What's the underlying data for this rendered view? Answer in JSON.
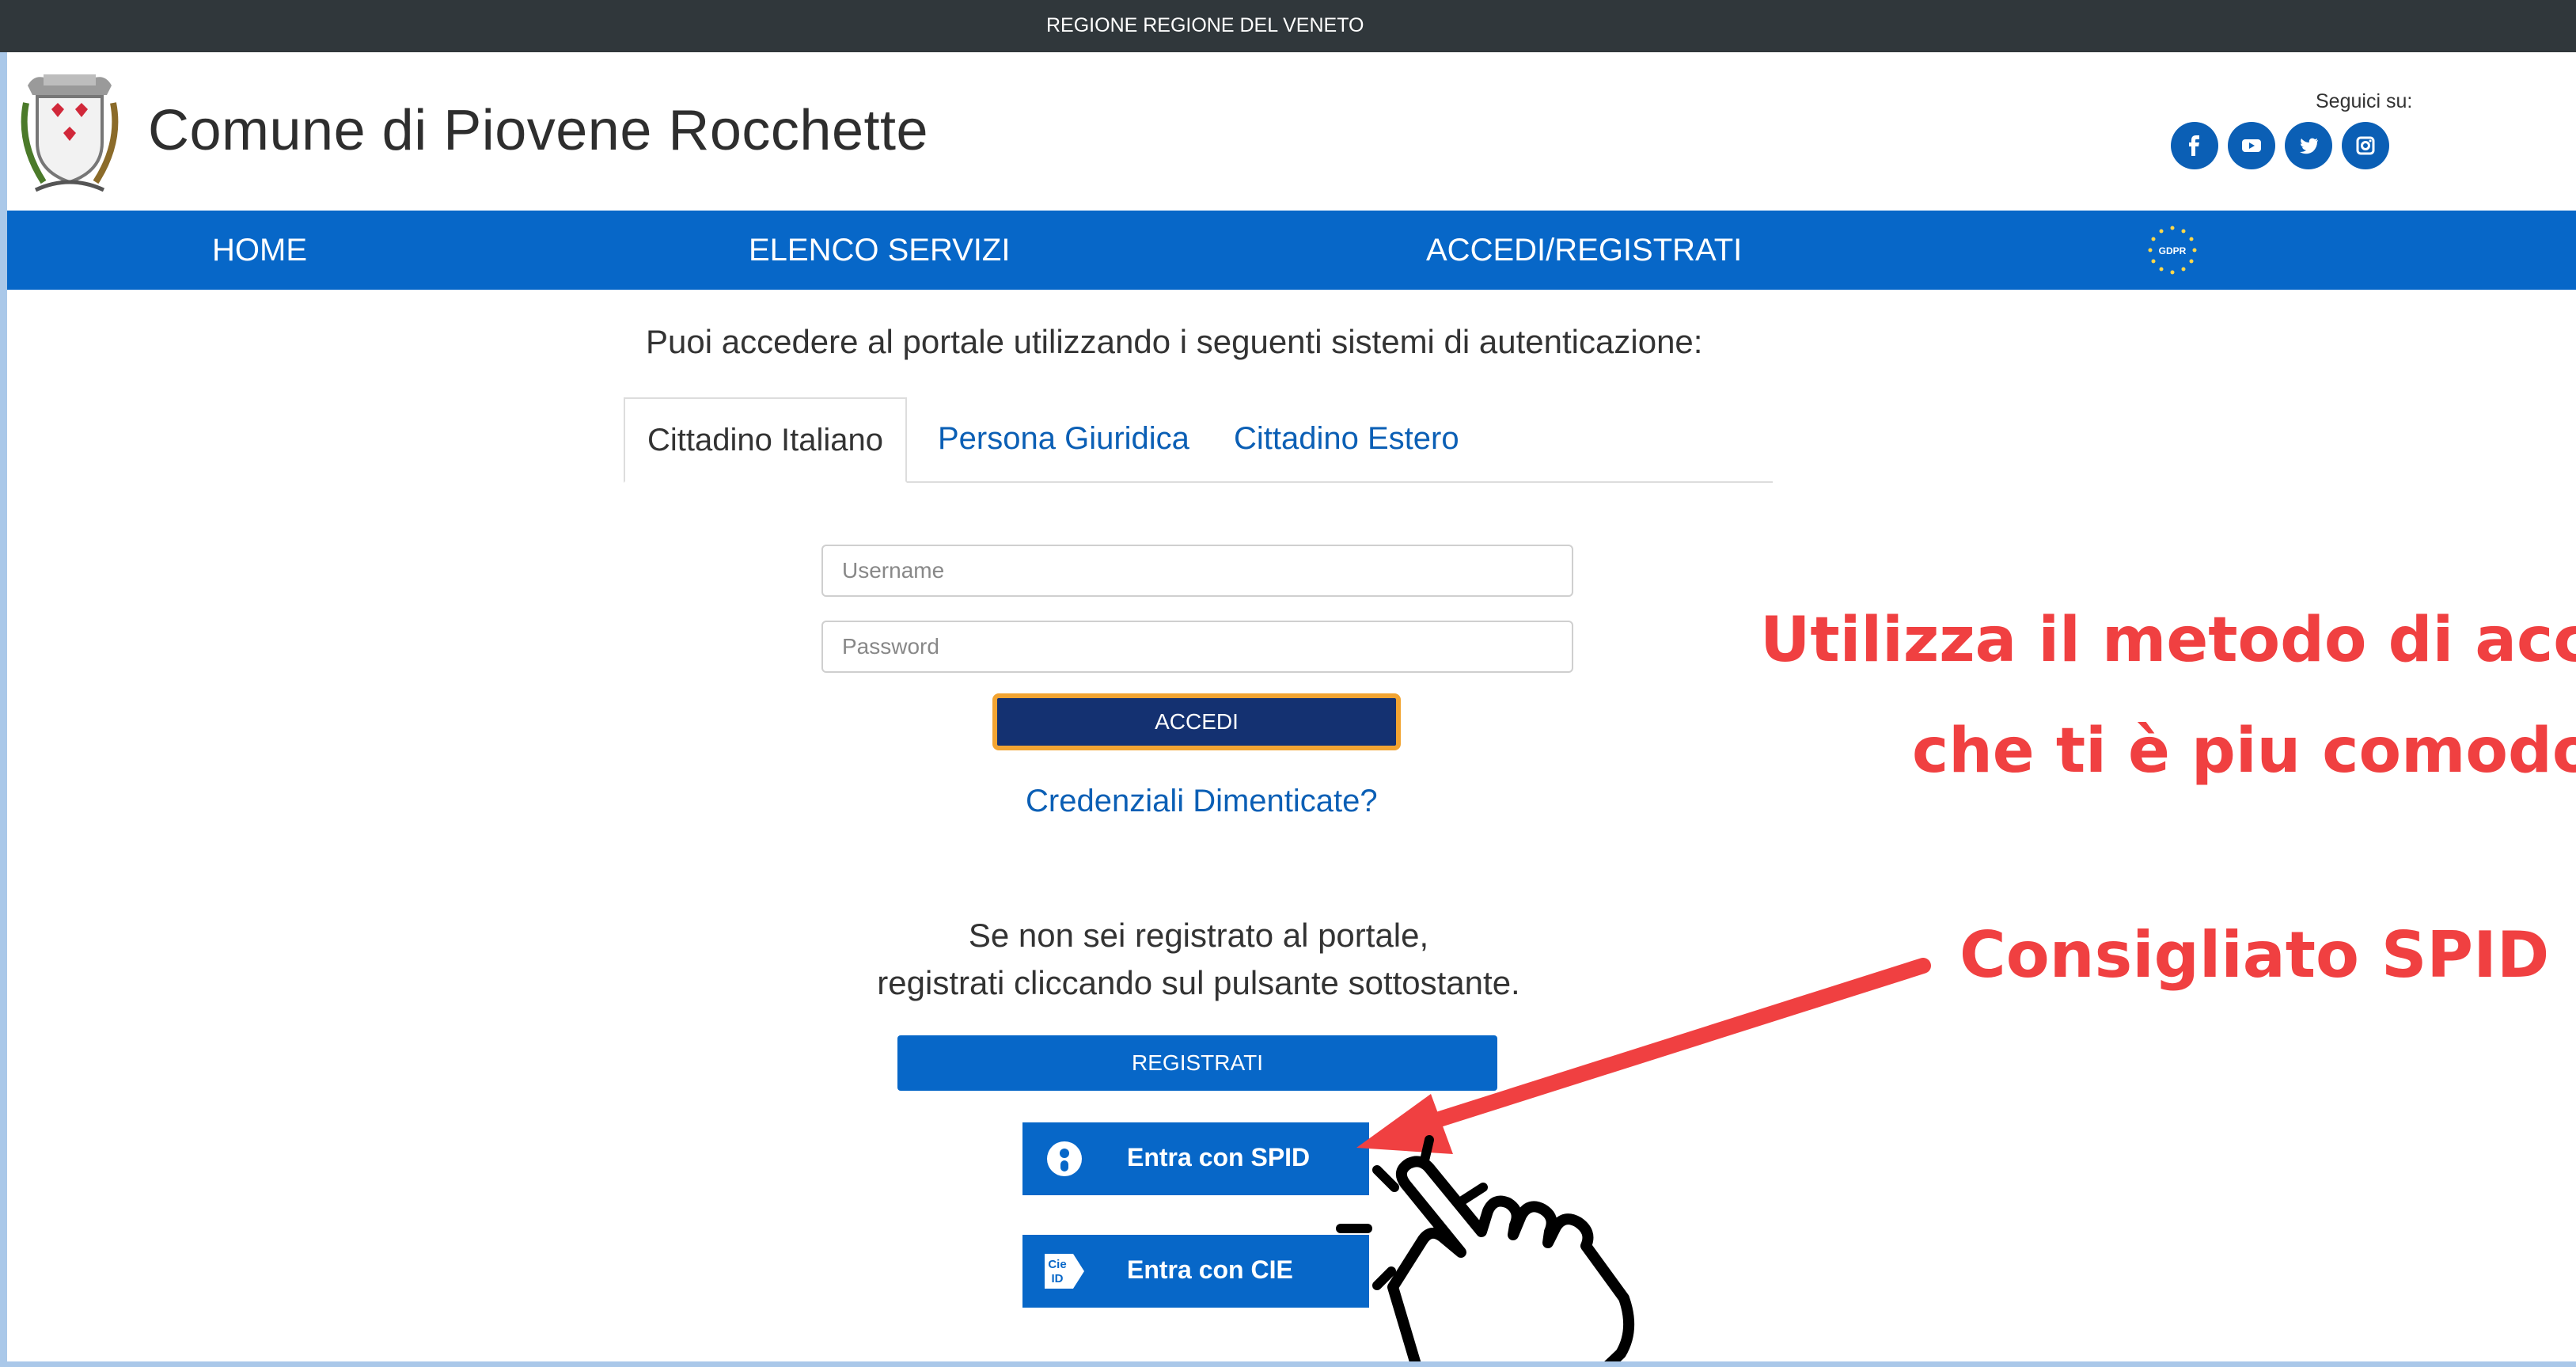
{
  "topbar": {
    "region_text": "REGIONE REGIONE DEL VENETO"
  },
  "header": {
    "site_title": "Comune di Piovene Rocchette",
    "follow_label": "Seguici su:",
    "social": [
      "facebook-icon",
      "youtube-icon",
      "twitter-icon",
      "instagram-icon"
    ]
  },
  "nav": {
    "items": [
      {
        "label": "HOME"
      },
      {
        "label": "ELENCO SERVIZI"
      },
      {
        "label": "ACCEDI/REGISTRATI"
      }
    ],
    "gdpr_label": "GDPR"
  },
  "login": {
    "intro": "Puoi accedere al portale utilizzando i seguenti sistemi di autenticazione:",
    "tabs": [
      {
        "label": "Cittadino Italiano",
        "active": true
      },
      {
        "label": "Persona Giuridica",
        "active": false
      },
      {
        "label": "Cittadino Estero",
        "active": false
      }
    ],
    "username_placeholder": "Username",
    "password_placeholder": "Password",
    "accedi_label": "ACCEDI",
    "forgot_label": "Credenziali Dimenticate?",
    "register_line1": "Se non sei registrato al portale,",
    "register_line2": "registrati cliccando sul pulsante sottostante.",
    "register_label": "REGISTRATI",
    "spid_label": "Entra con SPID",
    "cie_label": "Entra con CIE",
    "cie_icon_text": "Cie ID"
  },
  "annotation": {
    "line1": "Utilizza il metodo di acc",
    "line2": "che ti è piu comodo",
    "recommend": "Consigliato SPID"
  },
  "colors": {
    "topbar": "#30373b",
    "nav": "#0767c8",
    "accedi_bg": "#143171",
    "accedi_border": "#f2a432",
    "annotation": "#f04041",
    "link": "#0b5fb5"
  }
}
